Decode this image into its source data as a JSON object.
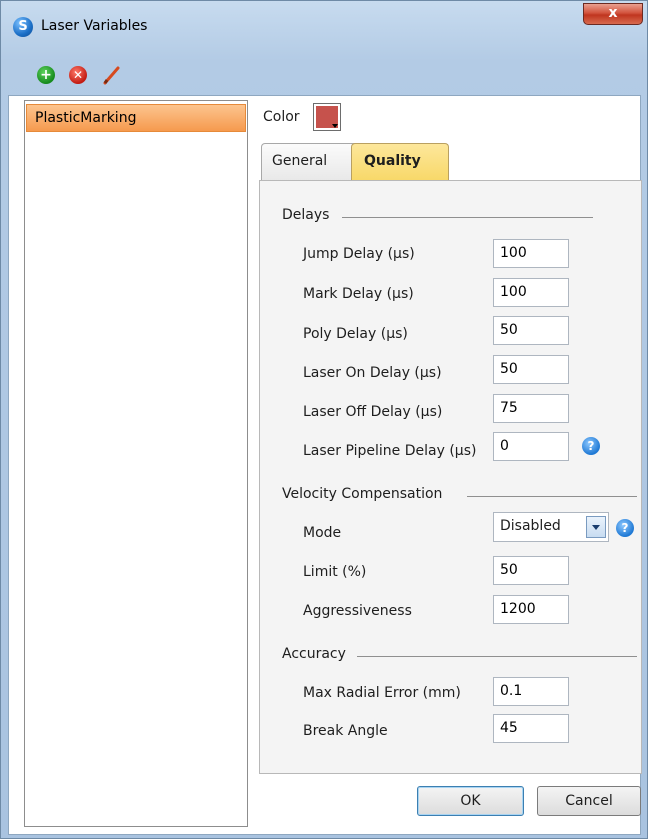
{
  "window": {
    "title": "Laser Variables",
    "close_glyph": "x",
    "app_icon_letter": "S"
  },
  "toolbar": {
    "add_icon": "plus-circle-icon",
    "delete_icon": "x-circle-icon",
    "edit_icon": "pencil-icon"
  },
  "list": {
    "items": [
      {
        "label": "PlasticMarking",
        "selected": true
      }
    ]
  },
  "color": {
    "label": "Color",
    "value": "#c6524c"
  },
  "tabs": [
    {
      "label": "General",
      "active": false
    },
    {
      "label": "Quality",
      "active": true
    }
  ],
  "delays": {
    "header": "Delays",
    "fields": [
      {
        "label": "Jump Delay (µs)",
        "value": "100"
      },
      {
        "label": "Mark Delay (µs)",
        "value": "100"
      },
      {
        "label": "Poly Delay (µs)",
        "value": "50"
      },
      {
        "label": "Laser On Delay (µs)",
        "value": "50"
      },
      {
        "label": "Laser Off Delay (µs)",
        "value": "75"
      },
      {
        "label": "Laser Pipeline Delay (µs)",
        "value": "0"
      }
    ]
  },
  "velocity": {
    "header": "Velocity Compensation",
    "mode_label": "Mode",
    "mode_value": "Disabled",
    "limit_label": "Limit (%)",
    "limit_value": "50",
    "aggr_label": "Aggressiveness",
    "aggr_value": "1200"
  },
  "accuracy": {
    "header": "Accuracy",
    "radial_label": "Max Radial Error (mm)",
    "radial_value": "0.1",
    "break_label": "Break Angle",
    "break_value": "45"
  },
  "help_glyph": "?",
  "buttons": {
    "ok": "OK",
    "cancel": "Cancel"
  }
}
